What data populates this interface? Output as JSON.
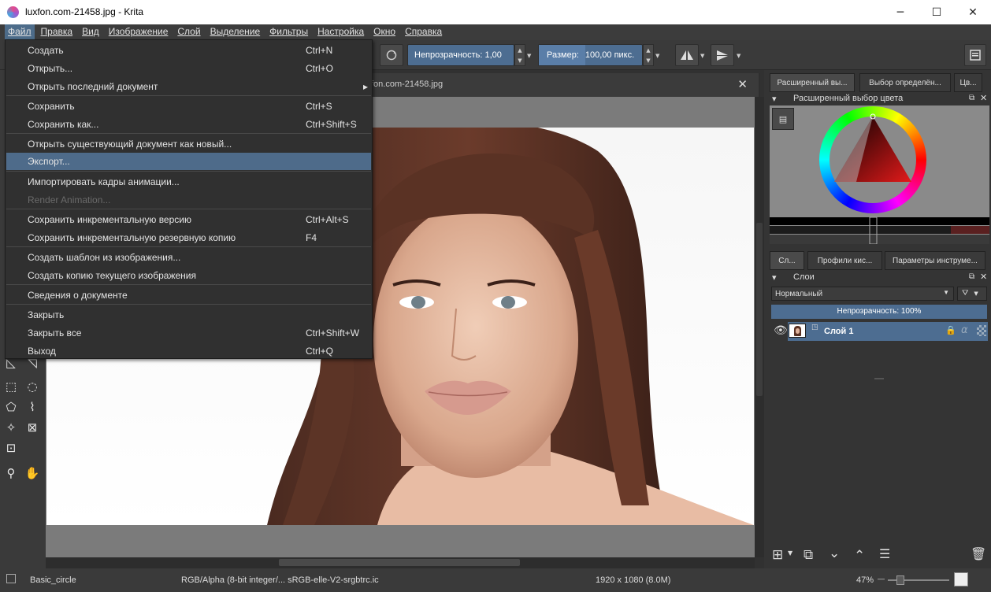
{
  "window": {
    "title": "luxfon.com-21458.jpg  - Krita",
    "minimize": "─",
    "maximize": "☐",
    "close": "✕"
  },
  "menubar": {
    "items": [
      "Файл",
      "Правка",
      "Вид",
      "Изображение",
      "Слой",
      "Выделение",
      "Фильтры",
      "Настройка",
      "Окно",
      "Справка"
    ]
  },
  "toolbar": {
    "opacity_label": "Непрозрачность:  1,00",
    "size_label": "Размер:",
    "size_value": "100,00 пикс."
  },
  "document": {
    "tab_title": "fon.com-21458.jpg",
    "close": "✕"
  },
  "file_menu": {
    "items": [
      {
        "label": "Создать",
        "shortcut": "Ctrl+N"
      },
      {
        "label": "Открыть...",
        "shortcut": "Ctrl+O"
      },
      {
        "label": "Открыть последний документ",
        "shortcut": "",
        "submenu": "▸"
      },
      {
        "label": "Сохранить",
        "shortcut": "Ctrl+S"
      },
      {
        "label": "Сохранить как...",
        "shortcut": "Ctrl+Shift+S"
      },
      {
        "label": "Открыть существующий документ как новый...",
        "shortcut": ""
      },
      {
        "label": "Экспорт...",
        "shortcut": ""
      },
      {
        "label": "Импортировать кадры анимации...",
        "shortcut": ""
      },
      {
        "label": "Render Animation...",
        "shortcut": ""
      },
      {
        "label": "Сохранить инкрементальную версию",
        "shortcut": "Ctrl+Alt+S"
      },
      {
        "label": "Сохранить инкрементальную резервную копию",
        "shortcut": "F4"
      },
      {
        "label": "Создать шаблон из изображения...",
        "shortcut": ""
      },
      {
        "label": "Создать копию текущего изображения",
        "shortcut": ""
      },
      {
        "label": "Сведения о документе",
        "shortcut": ""
      },
      {
        "label": "Закрыть",
        "shortcut": ""
      },
      {
        "label": "Закрыть все",
        "shortcut": "Ctrl+Shift+W"
      },
      {
        "label": "Выход",
        "shortcut": "Ctrl+Q"
      }
    ]
  },
  "dock": {
    "top_tabs": [
      "Расширенный вы...",
      "Выбор определён...",
      "Цв..."
    ],
    "color_panel_title": "Расширенный выбор цвета",
    "bottom_tabs": [
      "Сл...",
      "Профили кис...",
      "Параметры инструме..."
    ],
    "layers_title": "Слои",
    "blend_mode": "Нормальный",
    "opacity": "Непрозрачность:  100%",
    "layer_name": "Слой 1",
    "alpha_symbol": "α"
  },
  "status": {
    "brush": "Basic_circle",
    "color_profile": "RGB/Alpha (8-bit integer/... sRGB-elle-V2-srgbtrc.ic",
    "dimensions": "1920 x 1080 (8.0M)",
    "zoom": "47%"
  },
  "colors": {
    "accent": "#4d6d91",
    "highlight": "#4e6b8a",
    "background": "#313131"
  }
}
